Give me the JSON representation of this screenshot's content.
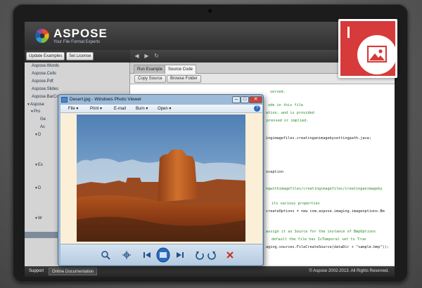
{
  "app": {
    "brand": "ASPOSE",
    "tagline": "Your File Format Experts",
    "colors": {
      "header": "#3a3a3a",
      "badge": "#d73a3a",
      "code_comment": "#2a8a2a"
    }
  },
  "left_toolbar": {
    "update_examples": "Update Examples",
    "set_license": "Set License"
  },
  "tree": {
    "items": [
      "Aspose.Words",
      "Aspose.Cells",
      "Aspose.Pdf",
      "Aspose.Slides",
      "Aspose.BarCode",
      "Aspose",
      "Pro",
      "Ge",
      "Ac",
      "D",
      "Ex",
      "D",
      "W"
    ]
  },
  "tabs": {
    "run_example": "Run Example",
    "source_code": "Source Code"
  },
  "subtoolbar": {
    "copy_source": "Copy Source",
    "browse_folder": "Browse Folder"
  },
  "code": {
    "lines": [
      "served.",
      "ode in this file",
      "ation, and is provided",
      "pressed or implied.",
      "ingimagefiles.creatinganimagebysettingpath.java;",
      "xception",
      "ngwithimagefiles/creatingimagefiles/creatinganimageby",
      "its various properties",
      "createOptions = new com.aspose.imaging.imageoptions.Bm",
      "assign it as Source for the instance of BmpOptions",
      "default the file has IsTemporal set to True",
      "aging.sources.FileCreateSource(dataDir + \"sample.bmp\"));"
    ]
  },
  "viewer": {
    "title": "Desert.jpg - Windows Photo Viewer",
    "menus": [
      "File",
      "Print",
      "E-mail",
      "Burn",
      "Open"
    ],
    "help": "?"
  },
  "footer": {
    "support": "Support",
    "online_documentation": "Online Documentation",
    "copyright": "© Aspose 2002-2013. All Rights Reserved."
  }
}
